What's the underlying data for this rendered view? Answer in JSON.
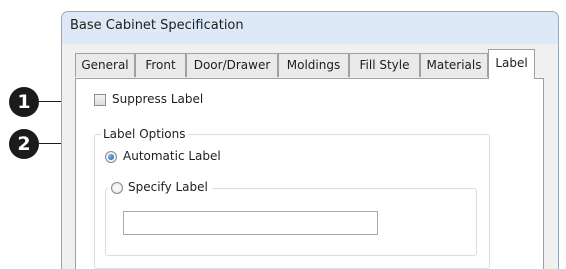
{
  "dialog": {
    "title": "Base Cabinet Specification"
  },
  "tabs": [
    {
      "label": "General",
      "active": false
    },
    {
      "label": "Front",
      "active": false
    },
    {
      "label": "Door/Drawer",
      "active": false
    },
    {
      "label": "Moldings",
      "active": false
    },
    {
      "label": "Fill Style",
      "active": false
    },
    {
      "label": "Materials",
      "active": false
    },
    {
      "label": "Label",
      "active": true
    }
  ],
  "panel": {
    "suppress_label": {
      "label": "Suppress Label",
      "checked": false
    },
    "label_options": {
      "caption": "Label Options",
      "automatic": {
        "label": "Automatic Label",
        "selected": true
      },
      "specify": {
        "label": "Specify Label",
        "selected": false,
        "value": ""
      }
    }
  },
  "callouts": [
    "1",
    "2"
  ],
  "colors": {
    "titlebar": "#dde9f7",
    "callout": "#1b1b1b",
    "radio_selected": "#1a5fb4"
  }
}
